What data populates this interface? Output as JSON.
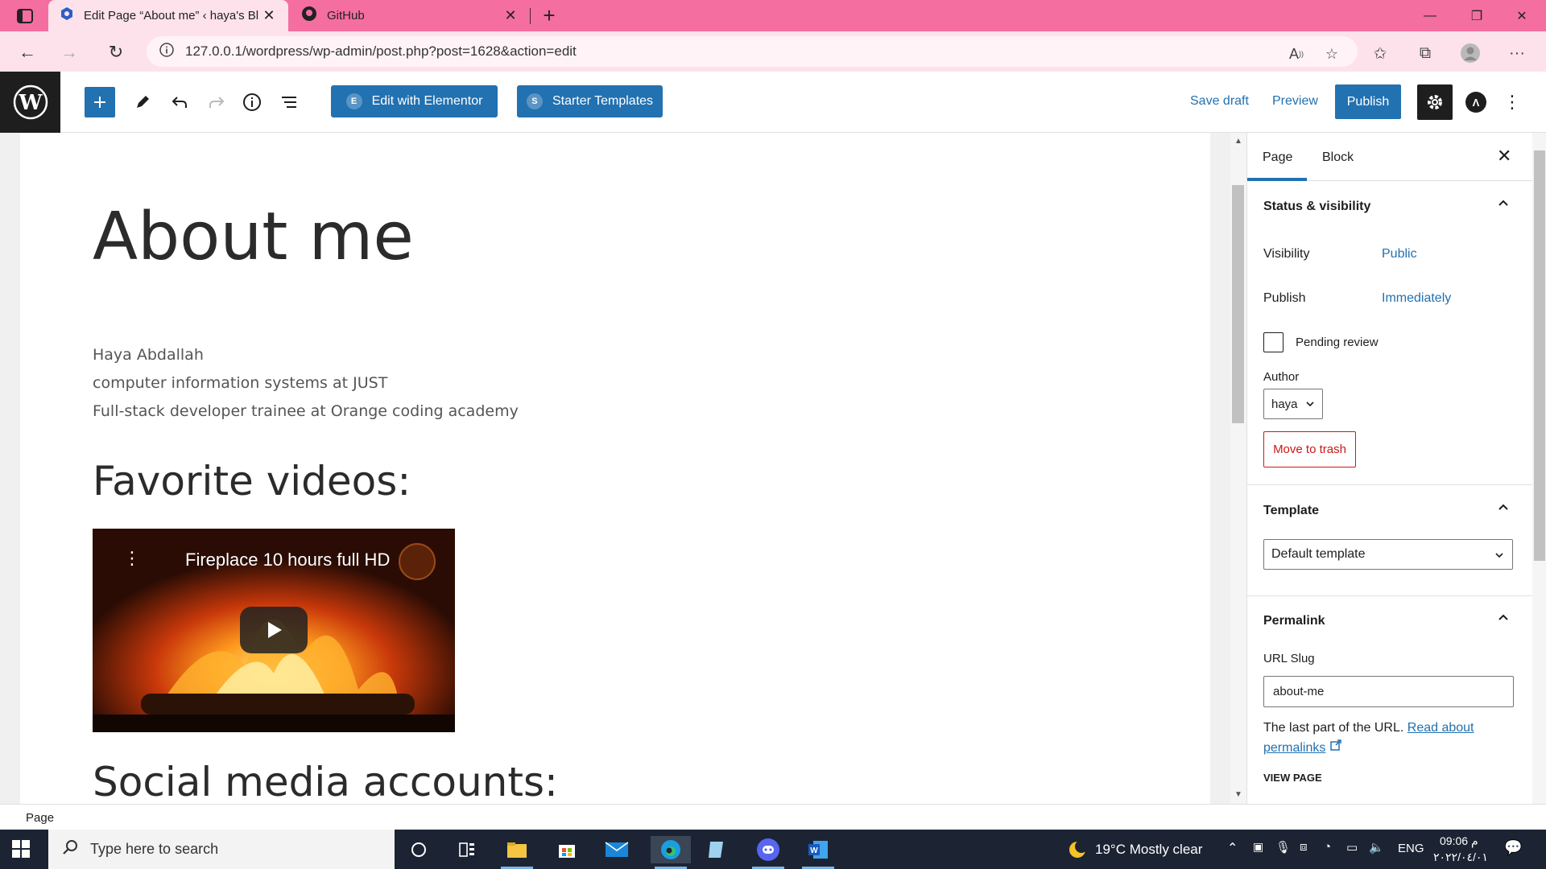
{
  "browser": {
    "tabs": [
      {
        "title": "Edit Page “About me” ‹ haya's Bl",
        "active": true
      },
      {
        "title": "GitHub",
        "active": false
      }
    ],
    "url": "127.0.0.1/wordpress/wp-admin/post.php?post=1628&action=edit"
  },
  "toolbar": {
    "elementor_label": "Edit with Elementor",
    "starter_label": "Starter Templates",
    "save_draft_label": "Save draft",
    "preview_label": "Preview",
    "publish_label": "Publish"
  },
  "content": {
    "title": "About me",
    "paragraphs": [
      "Haya Abdallah",
      "computer information systems at JUST",
      "Full-stack developer trainee at Orange coding academy"
    ],
    "heading_videos": "Favorite videos:",
    "video_title": "Fireplace 10 hours full HD",
    "heading_social": "Social media accounts:"
  },
  "sidebar": {
    "tabs": [
      "Page",
      "Block"
    ],
    "status_panel": {
      "title": "Status & visibility",
      "visibility_label": "Visibility",
      "visibility_value": "Public",
      "publish_label": "Publish",
      "publish_value": "Immediately",
      "pending_label": "Pending review",
      "author_label": "Author",
      "author_value": "haya",
      "trash_label": "Move to trash"
    },
    "template_panel": {
      "title": "Template",
      "value": "Default template"
    },
    "permalink_panel": {
      "title": "Permalink",
      "slug_label": "URL Slug",
      "slug_value": "about-me",
      "help_prefix": "The last part of the URL.",
      "help_link": "Read about permalinks",
      "view_page": "VIEW PAGE"
    }
  },
  "footer": {
    "breadcrumb": "Page"
  },
  "taskbar": {
    "search_placeholder": "Type here to search",
    "weather": "19°C  Mostly clear",
    "language": "ENG",
    "time": "09:06 م",
    "date": "٢٠٢٢/٠٤/٠١"
  },
  "colors": {
    "browser_tabbar": "#f56ea0",
    "browser_addrbar": "#fde2ec",
    "wp_blue": "#2271b1",
    "wp_dark": "#1e1e1e",
    "trash_red": "#cc1818"
  }
}
